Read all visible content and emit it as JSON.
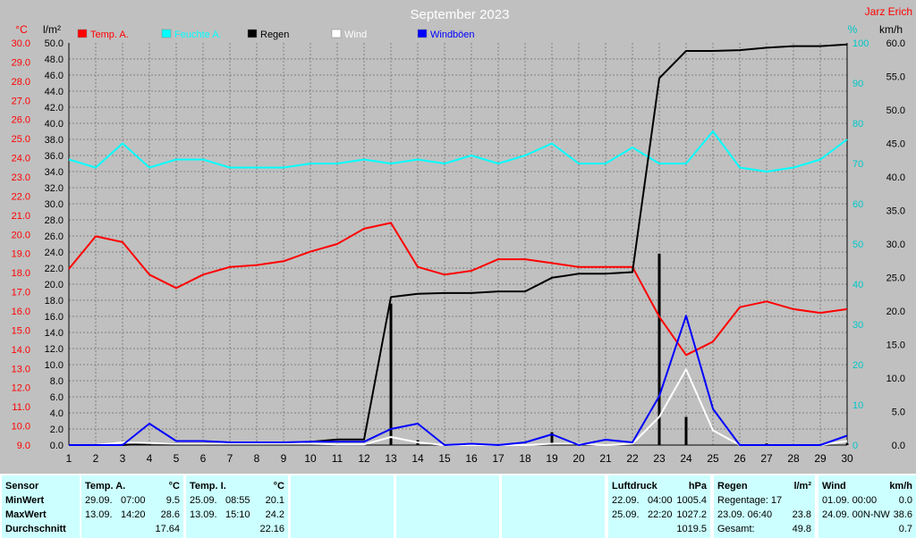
{
  "chart_data": {
    "type": "line",
    "title": "September 2023",
    "author": "Jarz Erich",
    "x": [
      1,
      2,
      3,
      4,
      5,
      6,
      7,
      8,
      9,
      10,
      11,
      12,
      13,
      14,
      15,
      16,
      17,
      18,
      19,
      20,
      21,
      22,
      23,
      24,
      25,
      26,
      27,
      28,
      29,
      30
    ],
    "xlim": [
      1,
      30
    ],
    "axes": {
      "temp_c": {
        "label": "°C",
        "min": 9.0,
        "max": 30.0,
        "ticks": [
          9.0,
          10.0,
          11.0,
          12.0,
          13.0,
          14.0,
          15.0,
          16.0,
          17.0,
          18.0,
          19.0,
          20.0,
          21.0,
          22.0,
          23.0,
          24.0,
          25.0,
          26.0,
          27.0,
          28.0,
          29.0,
          30.0
        ],
        "color": "#ff0000"
      },
      "rain_lm2": {
        "label": "l/m²",
        "min": 0.0,
        "max": 50.0,
        "ticks": [
          0.0,
          2.0,
          4.0,
          6.0,
          8.0,
          10.0,
          12.0,
          14.0,
          16.0,
          18.0,
          20.0,
          22.0,
          24.0,
          26.0,
          28.0,
          30.0,
          32.0,
          34.0,
          36.0,
          38.0,
          40.0,
          42.0,
          44.0,
          46.0,
          48.0,
          50.0
        ],
        "color": "#000000"
      },
      "humidity_pct": {
        "label": "%",
        "min": 0,
        "max": 100,
        "ticks": [
          0,
          10,
          20,
          30,
          40,
          50,
          60,
          70,
          80,
          90,
          100
        ],
        "color": "#00c8c8"
      },
      "wind_kmh": {
        "label": "km/h",
        "min": 0.0,
        "max": 60.0,
        "ticks": [
          0.0,
          5.0,
          10.0,
          15.0,
          20.0,
          25.0,
          30.0,
          35.0,
          40.0,
          45.0,
          50.0,
          55.0,
          60.0
        ],
        "color": "#000000"
      }
    },
    "legend": [
      {
        "name": "Temp. A.",
        "color": "#ff0000"
      },
      {
        "name": "Feuchte A.",
        "color": "#00ffff"
      },
      {
        "name": "Regen",
        "color": "#000000"
      },
      {
        "name": "Wind",
        "color": "#ffffff"
      },
      {
        "name": "Windböen",
        "color": "#0000ff"
      }
    ],
    "series": [
      {
        "name": "Temp. A.",
        "axis": "temp_c",
        "color": "#ff0000",
        "values": [
          18.2,
          19.9,
          19.6,
          17.9,
          17.2,
          17.9,
          18.3,
          18.4,
          18.6,
          19.1,
          19.5,
          20.3,
          20.6,
          18.3,
          17.9,
          18.1,
          18.7,
          18.7,
          18.5,
          18.3,
          18.3,
          18.3,
          15.7,
          13.7,
          14.4,
          16.2,
          16.5,
          16.1,
          15.9,
          16.1
        ]
      },
      {
        "name": "Feuchte A.",
        "axis": "humidity_pct",
        "color": "#00ffff",
        "values": [
          71,
          69,
          75,
          69,
          71,
          71,
          69,
          69,
          69,
          70,
          70,
          71,
          70,
          71,
          70,
          72,
          70,
          72,
          75,
          70,
          70,
          74,
          70,
          70,
          78,
          69,
          68,
          69,
          71,
          76
        ]
      },
      {
        "name": "Regen (kumuliert)",
        "axis": "rain_lm2",
        "color": "#000000",
        "values": [
          0,
          0,
          0,
          0.2,
          0.2,
          0.2,
          0.2,
          0.2,
          0.2,
          0.4,
          0.7,
          0.7,
          18.4,
          18.8,
          18.9,
          18.9,
          19.1,
          19.1,
          20.8,
          21.3,
          21.3,
          21.5,
          45.6,
          49.0,
          49.0,
          49.1,
          49.4,
          49.6,
          49.6,
          49.8
        ]
      },
      {
        "name": "Regen",
        "axis": "rain_lm2",
        "color": "#000000",
        "type": "bar",
        "values": [
          0,
          0,
          0,
          0.2,
          0,
          0,
          0,
          0,
          0,
          0.2,
          0.2,
          0,
          17.6,
          0.6,
          0,
          0,
          0,
          0,
          1.6,
          0.3,
          0,
          0,
          23.8,
          3.5,
          0,
          0,
          0.2,
          0,
          0,
          0.2
        ]
      },
      {
        "name": "Wind",
        "axis": "wind_kmh",
        "color": "#ffffff",
        "values": [
          0,
          0,
          0.4,
          0.3,
          0.2,
          0.2,
          0.2,
          0.2,
          0.2,
          0.2,
          0.1,
          0.1,
          1.2,
          0.4,
          0,
          0,
          0,
          0,
          0.2,
          0.2,
          0,
          0.2,
          4.2,
          11.3,
          2.2,
          0,
          0,
          0,
          0,
          0.6
        ]
      },
      {
        "name": "Windböen",
        "axis": "wind_kmh",
        "color": "#0000ff",
        "values": [
          0,
          0,
          0,
          3.2,
          0.6,
          0.6,
          0.4,
          0.4,
          0.4,
          0.5,
          0.5,
          0.5,
          2.4,
          3.2,
          0,
          0.2,
          0,
          0.4,
          1.6,
          0,
          0.8,
          0.4,
          7.3,
          19.3,
          5.4,
          0,
          0,
          0,
          0,
          1.4
        ]
      }
    ]
  },
  "stats": {
    "sensor": {
      "header": "Sensor",
      "rows": [
        "MinWert",
        "MaxWert",
        "Durchschnitt"
      ]
    },
    "temp_a": {
      "header": "Temp. A.",
      "unit": "°C",
      "rows": [
        {
          "date": "29.09.",
          "time": "07:00",
          "value": "9.5"
        },
        {
          "date": "13.09.",
          "time": "14:20",
          "value": "28.6"
        },
        {
          "date": "",
          "time": "",
          "value": "17.64"
        }
      ]
    },
    "temp_i": {
      "header": "Temp. I.",
      "unit": "°C",
      "rows": [
        {
          "date": "25.09.",
          "time": "08:55",
          "value": "20.1"
        },
        {
          "date": "13.09.",
          "time": "15:10",
          "value": "24.2"
        },
        {
          "date": "",
          "time": "",
          "value": "22.16"
        }
      ]
    },
    "luftdruck": {
      "header": "Luftdruck",
      "unit": "hPa",
      "rows": [
        {
          "date": "22.09.",
          "time": "04:00",
          "value": "1005.4"
        },
        {
          "date": "25.09.",
          "time": "22:20",
          "value": "1027.2"
        },
        {
          "date": "",
          "time": "",
          "value": "1019.5"
        }
      ]
    },
    "regen": {
      "header": "Regen",
      "unit": "l/m²",
      "rows": [
        {
          "label": "Regentage: 17",
          "value": ""
        },
        {
          "label": "23.09.  06:40",
          "value": "23.8"
        },
        {
          "label": "Gesamt:",
          "value": "49.8"
        }
      ]
    },
    "wind": {
      "header": "Wind",
      "unit": "km/h",
      "rows": [
        {
          "label": "01.09.  00:00",
          "value": "0.0"
        },
        {
          "label": "24.09.  00N-NW",
          "value": "38.6"
        },
        {
          "label": "",
          "value": "0.7"
        }
      ]
    }
  }
}
